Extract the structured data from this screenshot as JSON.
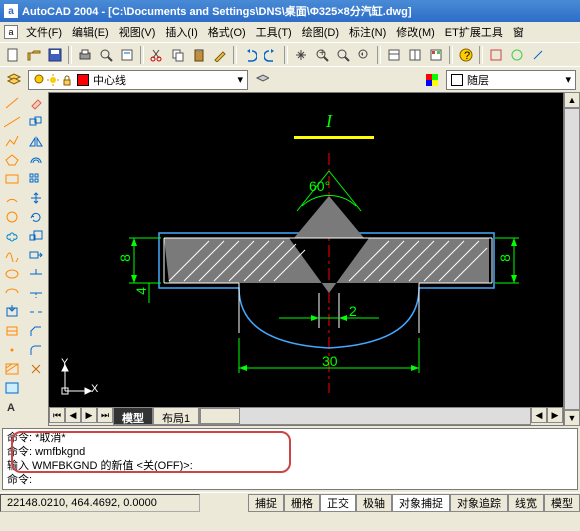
{
  "title": "AutoCAD 2004 - [C:\\Documents and Settings\\DNS\\桌面\\Φ325×8分汽缸.dwg]",
  "menu": {
    "file": "文件(F)",
    "edit": "编辑(E)",
    "view": "视图(V)",
    "insert": "插入(I)",
    "format": "格式(O)",
    "tools": "工具(T)",
    "draw": "绘图(D)",
    "dim": "标注(N)",
    "modify": "修改(M)",
    "ext": "ET扩展工具",
    "window": "窗"
  },
  "layer": {
    "current": "中心线",
    "bylayer": "随层"
  },
  "tabs": {
    "model": "模型",
    "layout1": "布局1"
  },
  "cmd": {
    "line1": "命令:  *取消*",
    "line2": "命令:  wmfbkgnd",
    "line3": "输入 WMFBKGND 的新值 <关(OFF)>:",
    "line4": "命令:"
  },
  "status": {
    "coords": "22148.0210, 464.4692, 0.0000",
    "snap": "捕捉",
    "grid": "栅格",
    "ortho": "正交",
    "polar": "极轴",
    "osnap": "对象捕捉",
    "otrack": "对象追踪",
    "lwt": "线宽",
    "model": "模型"
  },
  "drawing": {
    "angle_label": "60°",
    "dim_h1": "30",
    "dim_h2": "2",
    "dim_v1": "8",
    "dim_v2": "4",
    "dim_v3": "8",
    "italic_mark": "I",
    "ucs_x": "X",
    "ucs_y": "Y"
  },
  "icons": {
    "app": "a",
    "doc": "a"
  }
}
